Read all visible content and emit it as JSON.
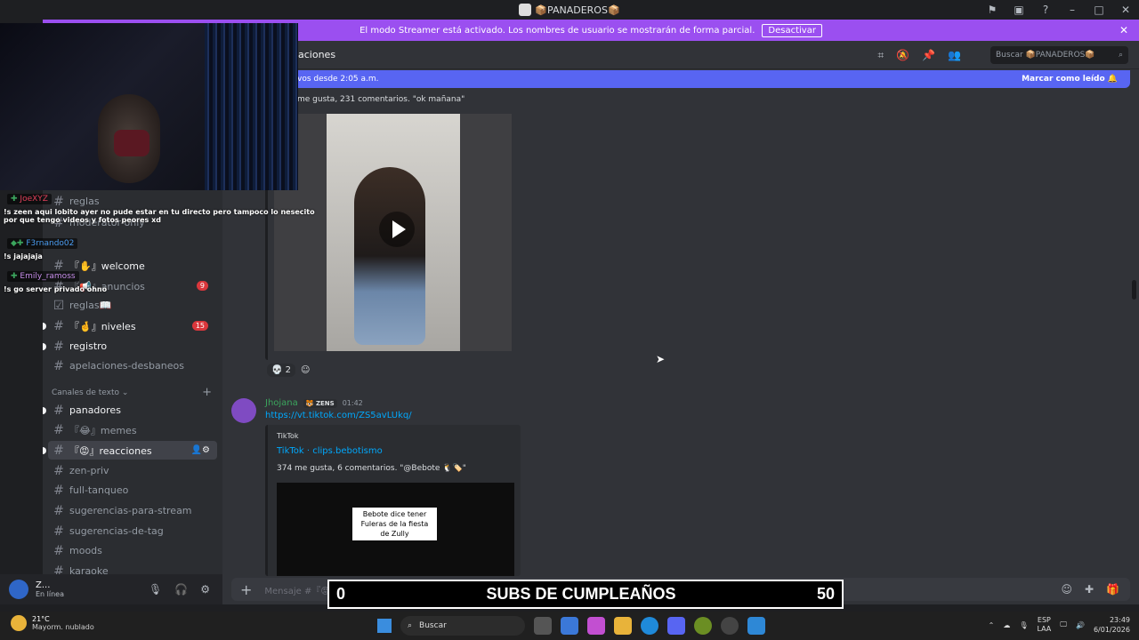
{
  "window": {
    "title": "📦PANADEROS📦"
  },
  "streamer_bar": {
    "text": "El modo Streamer está activado. Los nombres de usuario se mostrarán de forma parcial.",
    "button": "Desactivar"
  },
  "channel_header": {
    "name": "aciones",
    "search_placeholder": "Buscar 📦PANADEROS📦"
  },
  "new_messages": {
    "text": "vos desde 2:05 a.m.",
    "mark_read": "Marcar como leído"
  },
  "sidebar": {
    "channels_top": [
      {
        "label": "reglas"
      },
      {
        "label": "moderator-only"
      },
      {
        "label": "『✋』welcome"
      },
      {
        "label": "『📢』anuncios",
        "badge": "9"
      },
      {
        "label": "reglas📖"
      },
      {
        "label": "『🤞』niveles",
        "badge": "15"
      },
      {
        "label": "registro"
      },
      {
        "label": "apelaciones-desbaneos"
      }
    ],
    "category_text": "Canales de texto",
    "channels_text": [
      {
        "label": "panadores"
      },
      {
        "label": "『😂』memes"
      },
      {
        "label": "『😡』reacciones"
      },
      {
        "label": "zen-priv"
      },
      {
        "label": "full-tanqueo"
      },
      {
        "label": "sugerencias-para-stream"
      },
      {
        "label": "sugerencias-de-tag"
      },
      {
        "label": "moods"
      },
      {
        "label": "karaoke"
      }
    ]
  },
  "user_panel": {
    "name": "Z...",
    "status": "En línea"
  },
  "message1": {
    "summary": "me gusta, 231 comentarios. \"ok mañana\"",
    "reaction_count": "2"
  },
  "message2": {
    "author": "Jhojana",
    "tag": "ZENS",
    "time": "01:42",
    "link": "https://vt.tiktok.com/ZS5avLUkq/",
    "embed_provider": "TikTok",
    "embed_title": "TikTok · clips.bebotismo",
    "embed_desc": "374 me gusta, 6 comentarios. \"@Bebote 🐧🏷️\"",
    "video_caption": "Bebote dice tener Fuleras de la fiesta de Zully"
  },
  "composer": {
    "placeholder": "Mensaje #『😡』reacciones"
  },
  "chat_overlay": [
    {
      "user": "JoeXYZ",
      "color": "#e0405a",
      "text": "!s zeen aqui lobito ayer no pude estar en tu directo pero tampoco lo nesecito por que tengo videos y fotos peores xd"
    },
    {
      "user": "F3rnando02",
      "color": "#4a9cf0",
      "text": "!s jajajaja"
    },
    {
      "user": "Emily_ramoss",
      "color": "#c58ce8",
      "text": "!s go server privado ohno"
    }
  ],
  "stream_overlay": {
    "left": "0",
    "label": "SUBS DE CUMPLEAÑOS",
    "right": "50"
  },
  "taskbar": {
    "temp": "21°C",
    "weather": "Mayorm. nublado",
    "search": "Buscar",
    "lang1": "ESP",
    "lang2": "LAA",
    "time": "23:49",
    "date": "6/01/2026"
  }
}
